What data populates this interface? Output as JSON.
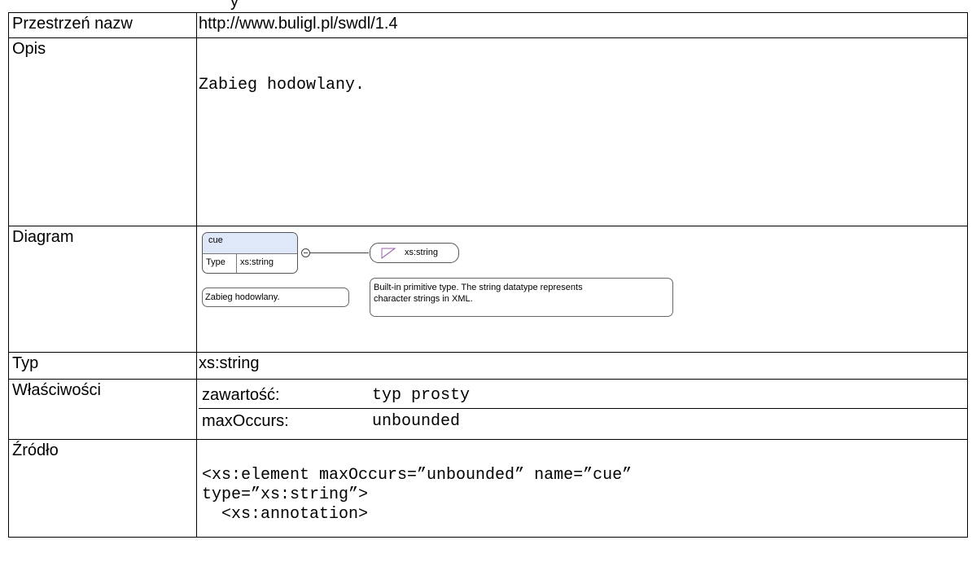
{
  "header": {
    "title": "y"
  },
  "rows": {
    "namespace": {
      "label": "Przestrzeń nazw",
      "value": "http://www.buligl.pl/swdl/1.4"
    },
    "description": {
      "label": "Opis",
      "value": "Zabieg hodowlany."
    },
    "diagram": {
      "label": "Diagram",
      "element_name": "cue",
      "type_key": "Type",
      "type_value": "xs:string",
      "element_annotation": "Zabieg hodowlany.",
      "type_node": "xs:string",
      "type_annotation_line1": "Built-in primitive type. The string datatype represents",
      "type_annotation_line2": "character strings in XML."
    },
    "type": {
      "label": "Typ",
      "value": "xs:string"
    },
    "properties": {
      "label": "Właściwości",
      "items": [
        {
          "key": "zawartość:",
          "value": "typ prosty"
        },
        {
          "key": "maxOccurs:",
          "value": "unbounded"
        }
      ]
    },
    "source": {
      "label": "Źródło",
      "lines": [
        "<xs:element maxOccurs=”unbounded” name=”cue”",
        "type=”xs:string”>",
        "  <xs:annotation>"
      ]
    }
  },
  "icons": {
    "diagram_type_icon": "simple-type-icon",
    "connector": "sequence-connector-icon"
  }
}
